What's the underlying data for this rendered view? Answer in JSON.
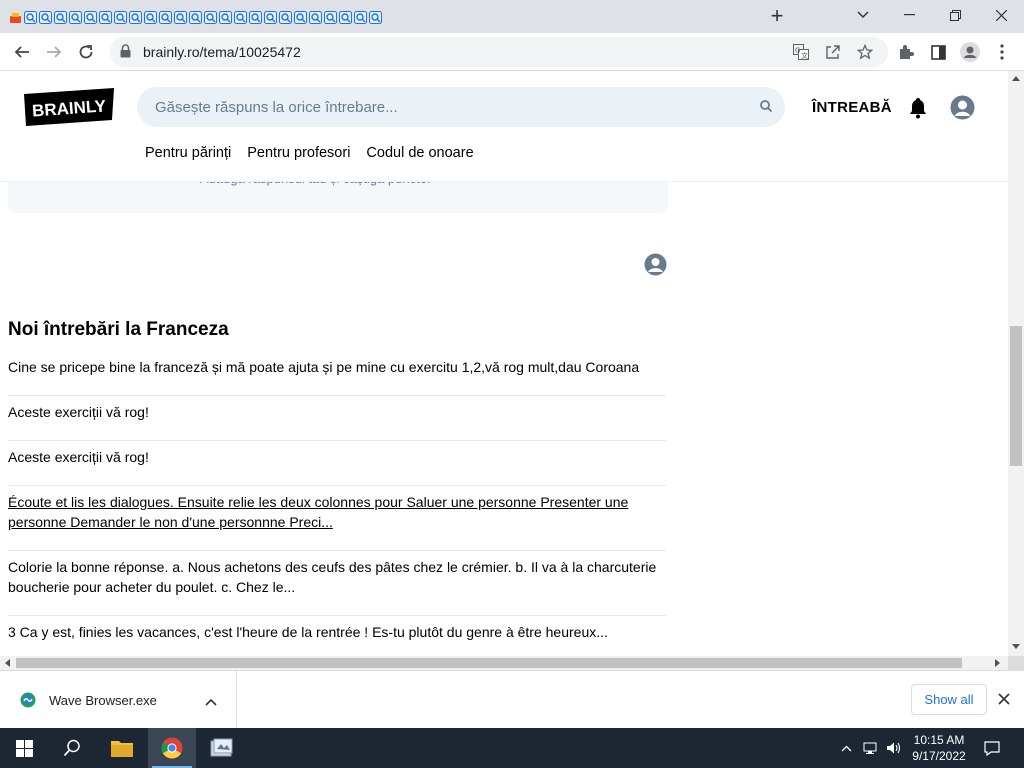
{
  "browser": {
    "tab_count": 25,
    "new_tab_label": "+",
    "url": "brainly.ro/tema/10025472"
  },
  "site": {
    "logo_text": "BRAINLY",
    "search_placeholder": "Găsește răspuns la orice întrebare...",
    "ask_label": "ÎNTREABĂ",
    "nav": [
      "Pentru părinți",
      "Pentru profesori",
      "Codul de onoare"
    ],
    "answer_hint": "Adaugă răspunsul tău și câștigă puncte.",
    "section_title": "Noi întrebări la Franceza",
    "questions": [
      {
        "text": "Cine se pricepe bine la franceză și mă poate ajuta și pe mine cu exercitu 1,2,vă rog mult,dau Coroana",
        "link": false
      },
      {
        "text": "Aceste exerciții vă rog!",
        "link": false
      },
      {
        "text": "Aceste exerciții vă rog!",
        "link": false
      },
      {
        "text": "Écoute et lis les dialogues. Ensuite relie les deux colonnes pour Saluer une personne Presenter une personne Demander le non d'une personnne Preci...",
        "link": true
      },
      {
        "text": "Colorie la bonne réponse. a. Nous achetons des ceufs des pâtes chez le crémier. b. Il va à la charcuterie boucherie pour acheter du poulet. c. Chez le...",
        "link": false
      },
      {
        "text": "3 Ca y est, finies les vacances, c'est l'heure de la rentrée ! Es-tu plutôt du genre à être heureux...",
        "link": false
      }
    ]
  },
  "downloads": {
    "file_name": "Wave Browser.exe",
    "show_all_label": "Show all"
  },
  "taskbar": {
    "time": "10:15 AM",
    "date": "9/17/2022"
  },
  "colors": {
    "brainly_black": "#000000",
    "search_bg": "#ebf2f7",
    "link_blue": "#1a73e8",
    "taskbar": "#1c2733"
  }
}
